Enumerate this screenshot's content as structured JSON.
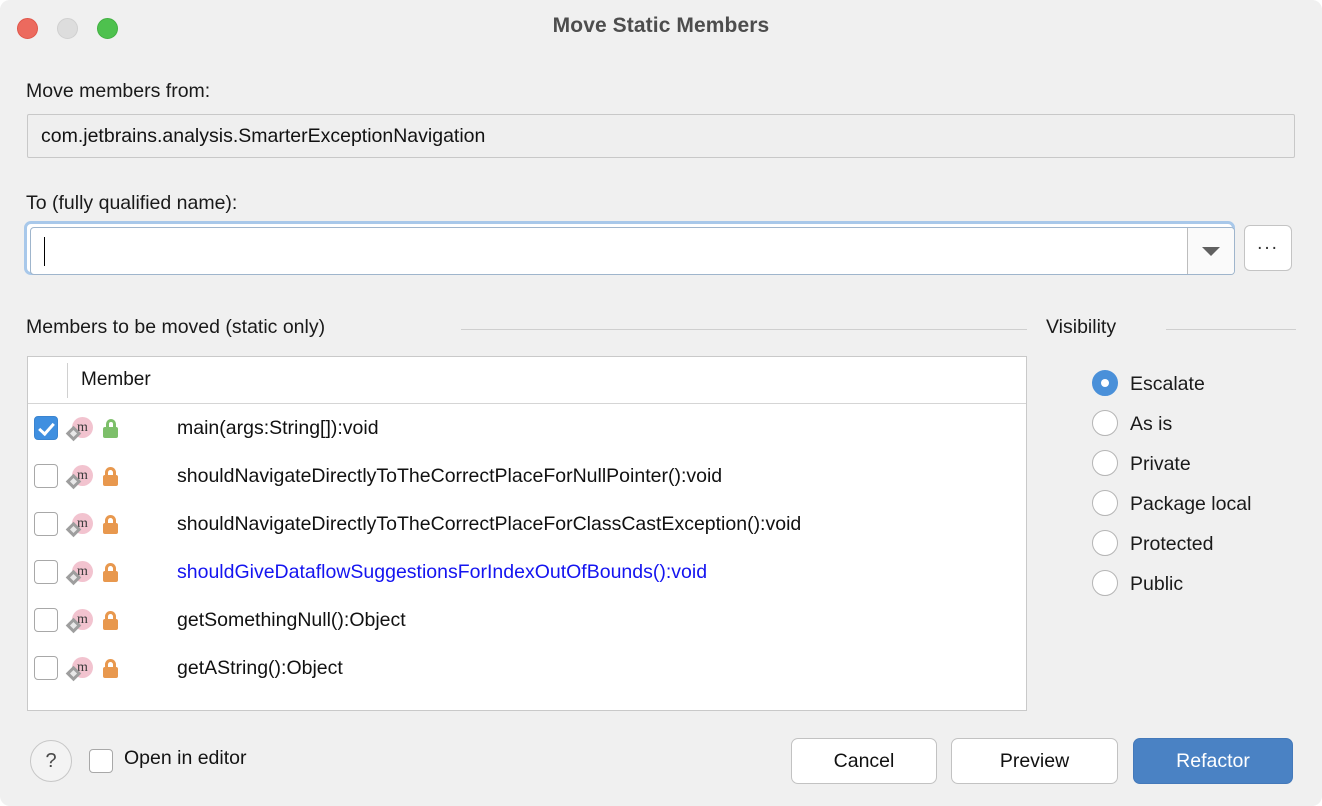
{
  "window": {
    "title": "Move Static Members",
    "traffic_lights": [
      {
        "name": "close",
        "color": "#ec6a5e"
      },
      {
        "name": "minimize",
        "color": "#dddddd"
      },
      {
        "name": "zoom",
        "color": "#4ec14e"
      }
    ]
  },
  "source": {
    "label": "Move members from:",
    "value": "com.jetbrains.analysis.SmarterExceptionNavigation"
  },
  "target": {
    "label": "To (fully qualified name):",
    "value": "",
    "placeholder": "",
    "browse_button_label": "...",
    "dropdown_icon": "chevron-down-icon"
  },
  "members_section": {
    "title": "Members to be moved (static only)",
    "column_headers": [
      "",
      "Member"
    ],
    "rows": [
      {
        "checked": true,
        "icon": "method-icon",
        "static_marker": "static-diamond-icon",
        "lock": "unlock-icon",
        "lock_state": "open",
        "name": "main(args:String[]):void",
        "highlighted": false
      },
      {
        "checked": false,
        "icon": "method-icon",
        "static_marker": "static-diamond-icon",
        "lock": "lock-icon",
        "lock_state": "closed",
        "name": "shouldNavigateDirectlyToTheCorrectPlaceForNullPointer():void",
        "highlighted": false
      },
      {
        "checked": false,
        "icon": "method-icon",
        "static_marker": "static-diamond-icon",
        "lock": "lock-icon",
        "lock_state": "closed",
        "name": "shouldNavigateDirectlyToTheCorrectPlaceForClassCastException():void",
        "highlighted": false
      },
      {
        "checked": false,
        "icon": "method-icon",
        "static_marker": "static-diamond-icon",
        "lock": "lock-icon",
        "lock_state": "closed",
        "name": "shouldGiveDataflowSuggestionsForIndexOutOfBounds():void",
        "highlighted": true
      },
      {
        "checked": false,
        "icon": "method-icon",
        "static_marker": "static-diamond-icon",
        "lock": "lock-icon",
        "lock_state": "closed",
        "name": "getSomethingNull():Object",
        "highlighted": false
      },
      {
        "checked": false,
        "icon": "method-icon",
        "static_marker": "static-diamond-icon",
        "lock": "lock-icon",
        "lock_state": "closed",
        "name": "getAString():Object",
        "highlighted": false
      }
    ]
  },
  "visibility": {
    "title": "Visibility",
    "selected": "Escalate",
    "options": [
      {
        "label": "Escalate",
        "selected": true
      },
      {
        "label": "As is",
        "selected": false
      },
      {
        "label": "Private",
        "selected": false
      },
      {
        "label": "Package local",
        "selected": false
      },
      {
        "label": "Protected",
        "selected": false
      },
      {
        "label": "Public",
        "selected": false
      }
    ]
  },
  "footer": {
    "help_label": "?",
    "open_in_editor": {
      "label": "Open in editor",
      "checked": false
    },
    "cancel_label": "Cancel",
    "preview_label": "Preview",
    "refactor_label": "Refactor"
  },
  "colors": {
    "accent": "#4a82c4",
    "selection": "#3f8fe0",
    "highlight_text": "#1414f0",
    "method_icon": "#f2c3cf",
    "lock_closed": "#e8984e",
    "lock_open": "#7dbf6a",
    "dialog_bg": "#f0f0f0"
  }
}
